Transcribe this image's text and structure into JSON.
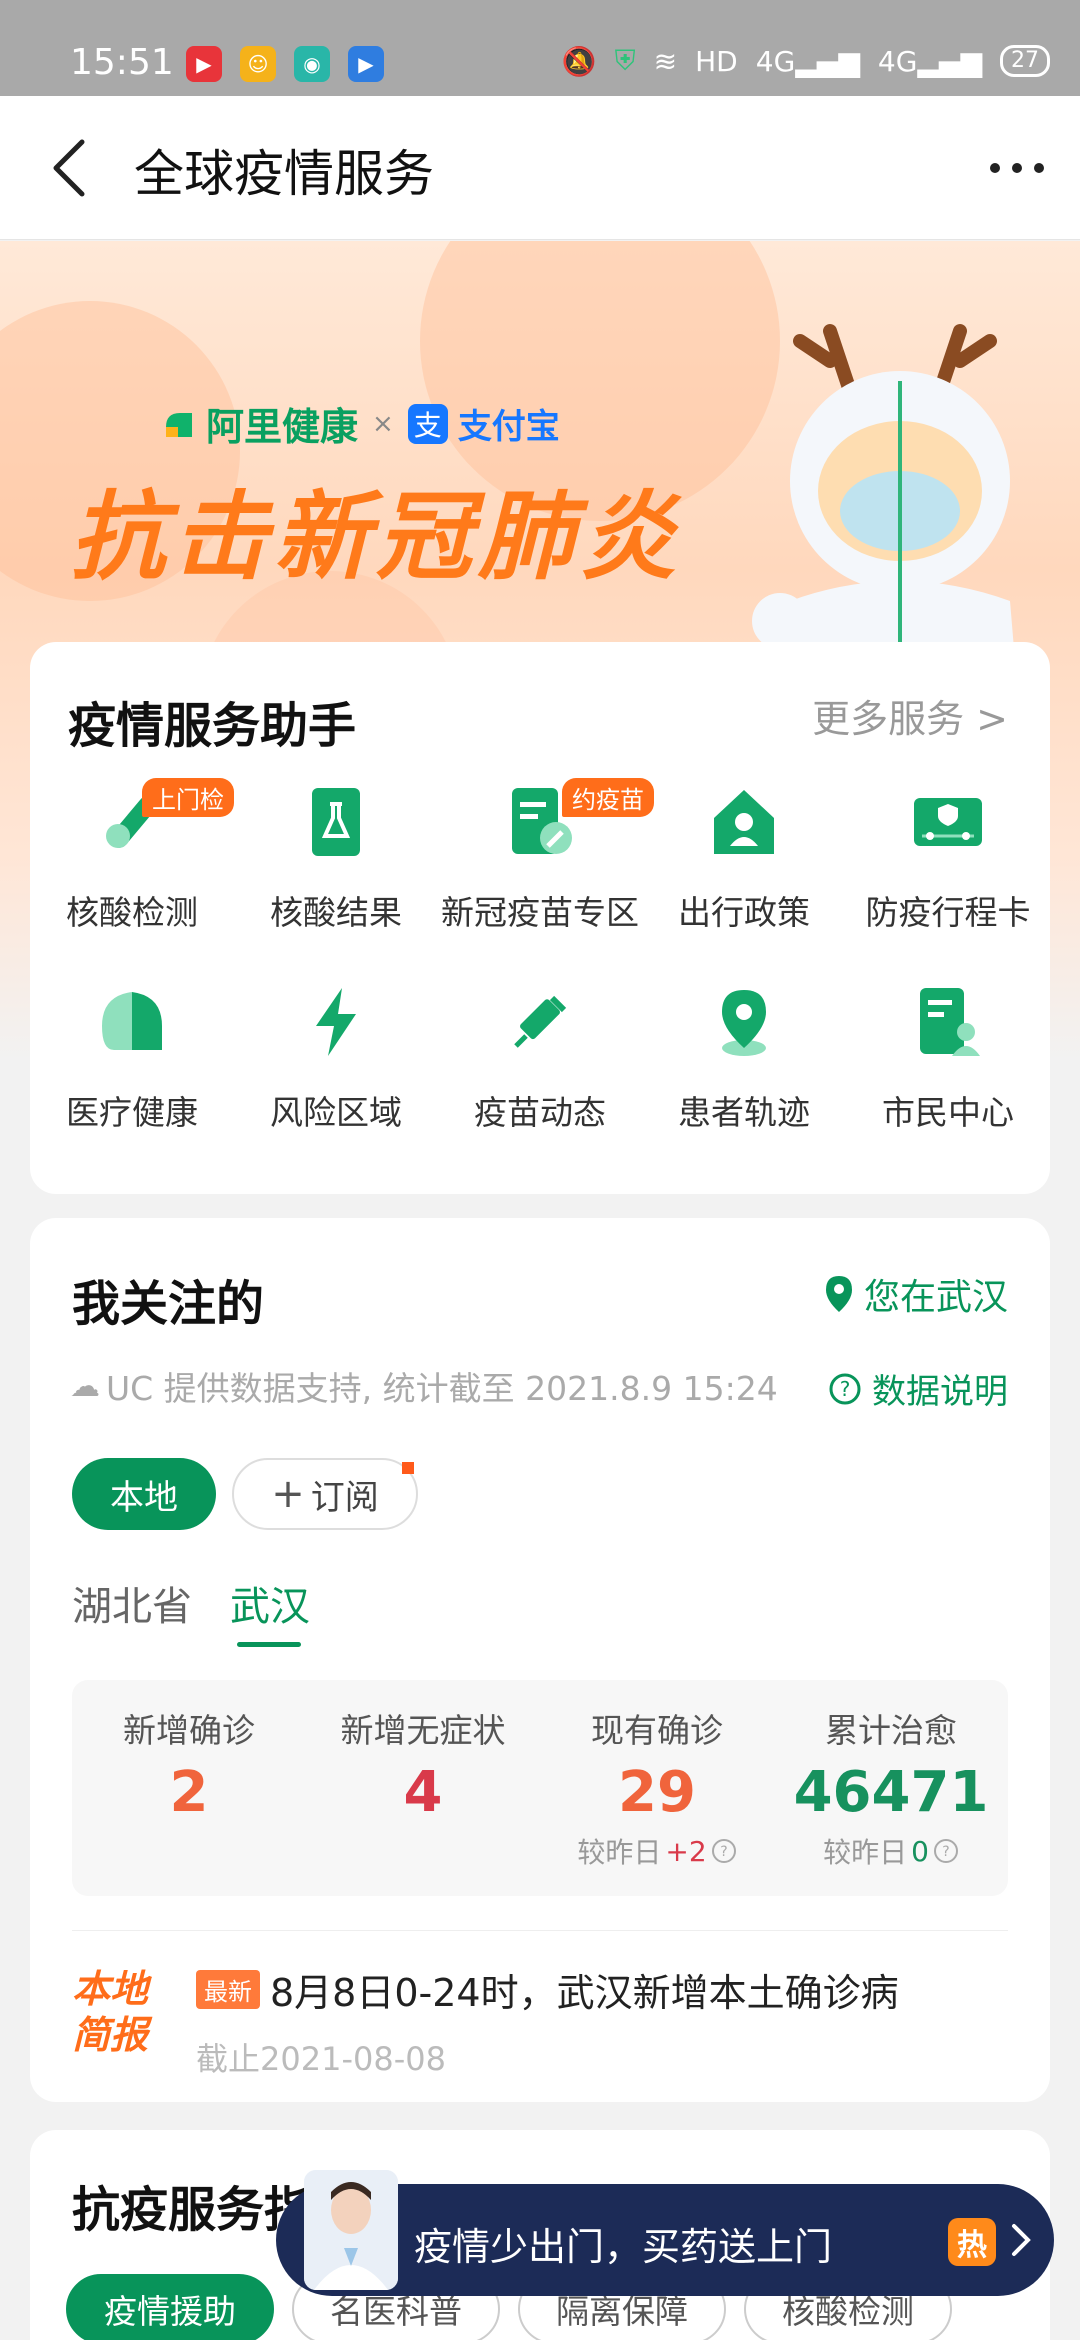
{
  "status_bar": {
    "time": "15:51",
    "network": "HD",
    "signal1": "4G",
    "signal2": "4G",
    "battery": "27"
  },
  "header": {
    "title": "全球疫情服务"
  },
  "banner": {
    "brand_ali": "阿里健康",
    "brand_sep": "×",
    "brand_alipay": "支付宝",
    "slogan": "抗击新冠肺炎"
  },
  "services": {
    "title": "疫情服务助手",
    "more": "更多服务 >",
    "items": [
      {
        "label": "核酸检测",
        "badge": "上门检",
        "icon": "test-tube-icon"
      },
      {
        "label": "核酸结果",
        "icon": "flask-document-icon"
      },
      {
        "label": "新冠疫苗专区",
        "badge": "约疫苗",
        "icon": "vaccine-document-icon"
      },
      {
        "label": "出行政策",
        "icon": "house-person-icon"
      },
      {
        "label": "防疫行程卡",
        "icon": "route-card-icon"
      },
      {
        "label": "医疗健康",
        "icon": "health-shield-icon"
      },
      {
        "label": "风险区域",
        "icon": "lightning-icon"
      },
      {
        "label": "疫苗动态",
        "icon": "syringe-icon"
      },
      {
        "label": "患者轨迹",
        "icon": "map-pin-icon"
      },
      {
        "label": "市民中心",
        "icon": "citizen-document-icon"
      }
    ]
  },
  "follow": {
    "title": "我关注的",
    "location": "您在武汉",
    "source": "UC 提供数据支持, 统计截至 2021.8.9 15:24",
    "data_note": "数据说明",
    "pill_local": "本地",
    "pill_subscribe": "订阅",
    "tab_province": "湖北省",
    "tab_city": "武汉",
    "stats": [
      {
        "name": "新增确诊",
        "value": "2",
        "color": "#f0643c"
      },
      {
        "name": "新增无症状",
        "value": "4",
        "color": "#d93a4a"
      },
      {
        "name": "现有确诊",
        "value": "29",
        "color": "#f0643c",
        "diff_label": "较昨日",
        "diff_value": "+2",
        "diff_color": "#d93a4a"
      },
      {
        "name": "累计治愈",
        "value": "46471",
        "color": "#17915e",
        "diff_label": "较昨日",
        "diff_value": "0",
        "diff_color": "#17915e"
      }
    ],
    "brief_logo": "本地简报",
    "brief_tag": "最新",
    "brief_text": "8月8日0-24时，武汉新增本土确诊病",
    "brief_date": "截止2021-08-08"
  },
  "anti": {
    "title": "抗疫服务指",
    "chips": [
      "疫情援助",
      "名医科普",
      "隔离保障",
      "核酸检测"
    ]
  },
  "promo": {
    "text": "疫情少出门，买药送上门",
    "hot": "热"
  }
}
